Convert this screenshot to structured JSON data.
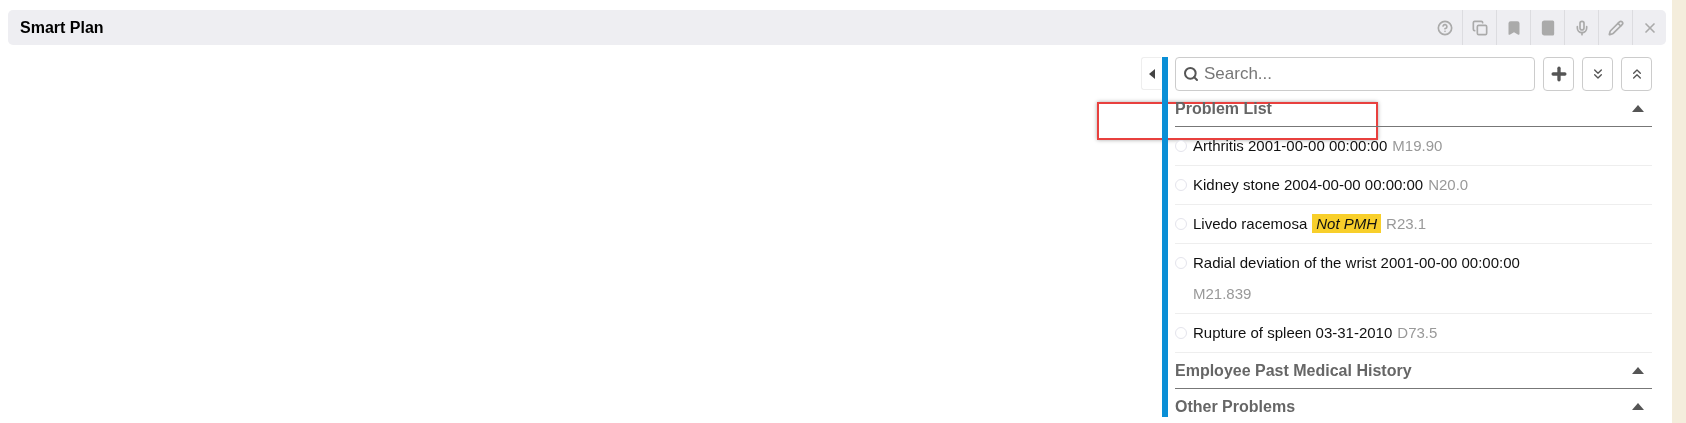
{
  "window": {
    "title": "Smart Plan"
  },
  "toolbar": [
    {
      "kind": "help"
    },
    {
      "kind": "copy"
    },
    {
      "kind": "bookmark"
    },
    {
      "kind": "book"
    },
    {
      "kind": "microphone"
    },
    {
      "kind": "edit"
    },
    {
      "kind": "close"
    }
  ],
  "panel": {
    "collapsed": false
  },
  "search": {
    "placeholder": "Search..."
  },
  "actions": [
    {
      "kind": "add"
    },
    {
      "kind": "expand"
    },
    {
      "kind": "collapse"
    }
  ],
  "sections": [
    {
      "title": "Problem List",
      "expanded": true,
      "highlighted": true,
      "items": [
        {
          "text": "Arthritis 2001-00-00 00:00:00",
          "code": "M19.90",
          "selected": false
        },
        {
          "text": "Kidney stone 2004-00-00 00:00:00",
          "code": "N20.0",
          "selected": false
        },
        {
          "text": "Livedo racemosa",
          "tag": "Not PMH",
          "code": "R23.1",
          "selected": false
        },
        {
          "text": "Radial deviation of the wrist 2001-00-00 00:00:00",
          "code": "M21.839",
          "selected": false
        },
        {
          "text": "Rupture of spleen 03-31-2010",
          "code": "D73.5",
          "selected": false
        }
      ]
    },
    {
      "title": "Employee Past Medical History",
      "expanded": true,
      "highlighted": false
    },
    {
      "title": "Other Problems",
      "expanded": true,
      "highlighted": false
    }
  ]
}
